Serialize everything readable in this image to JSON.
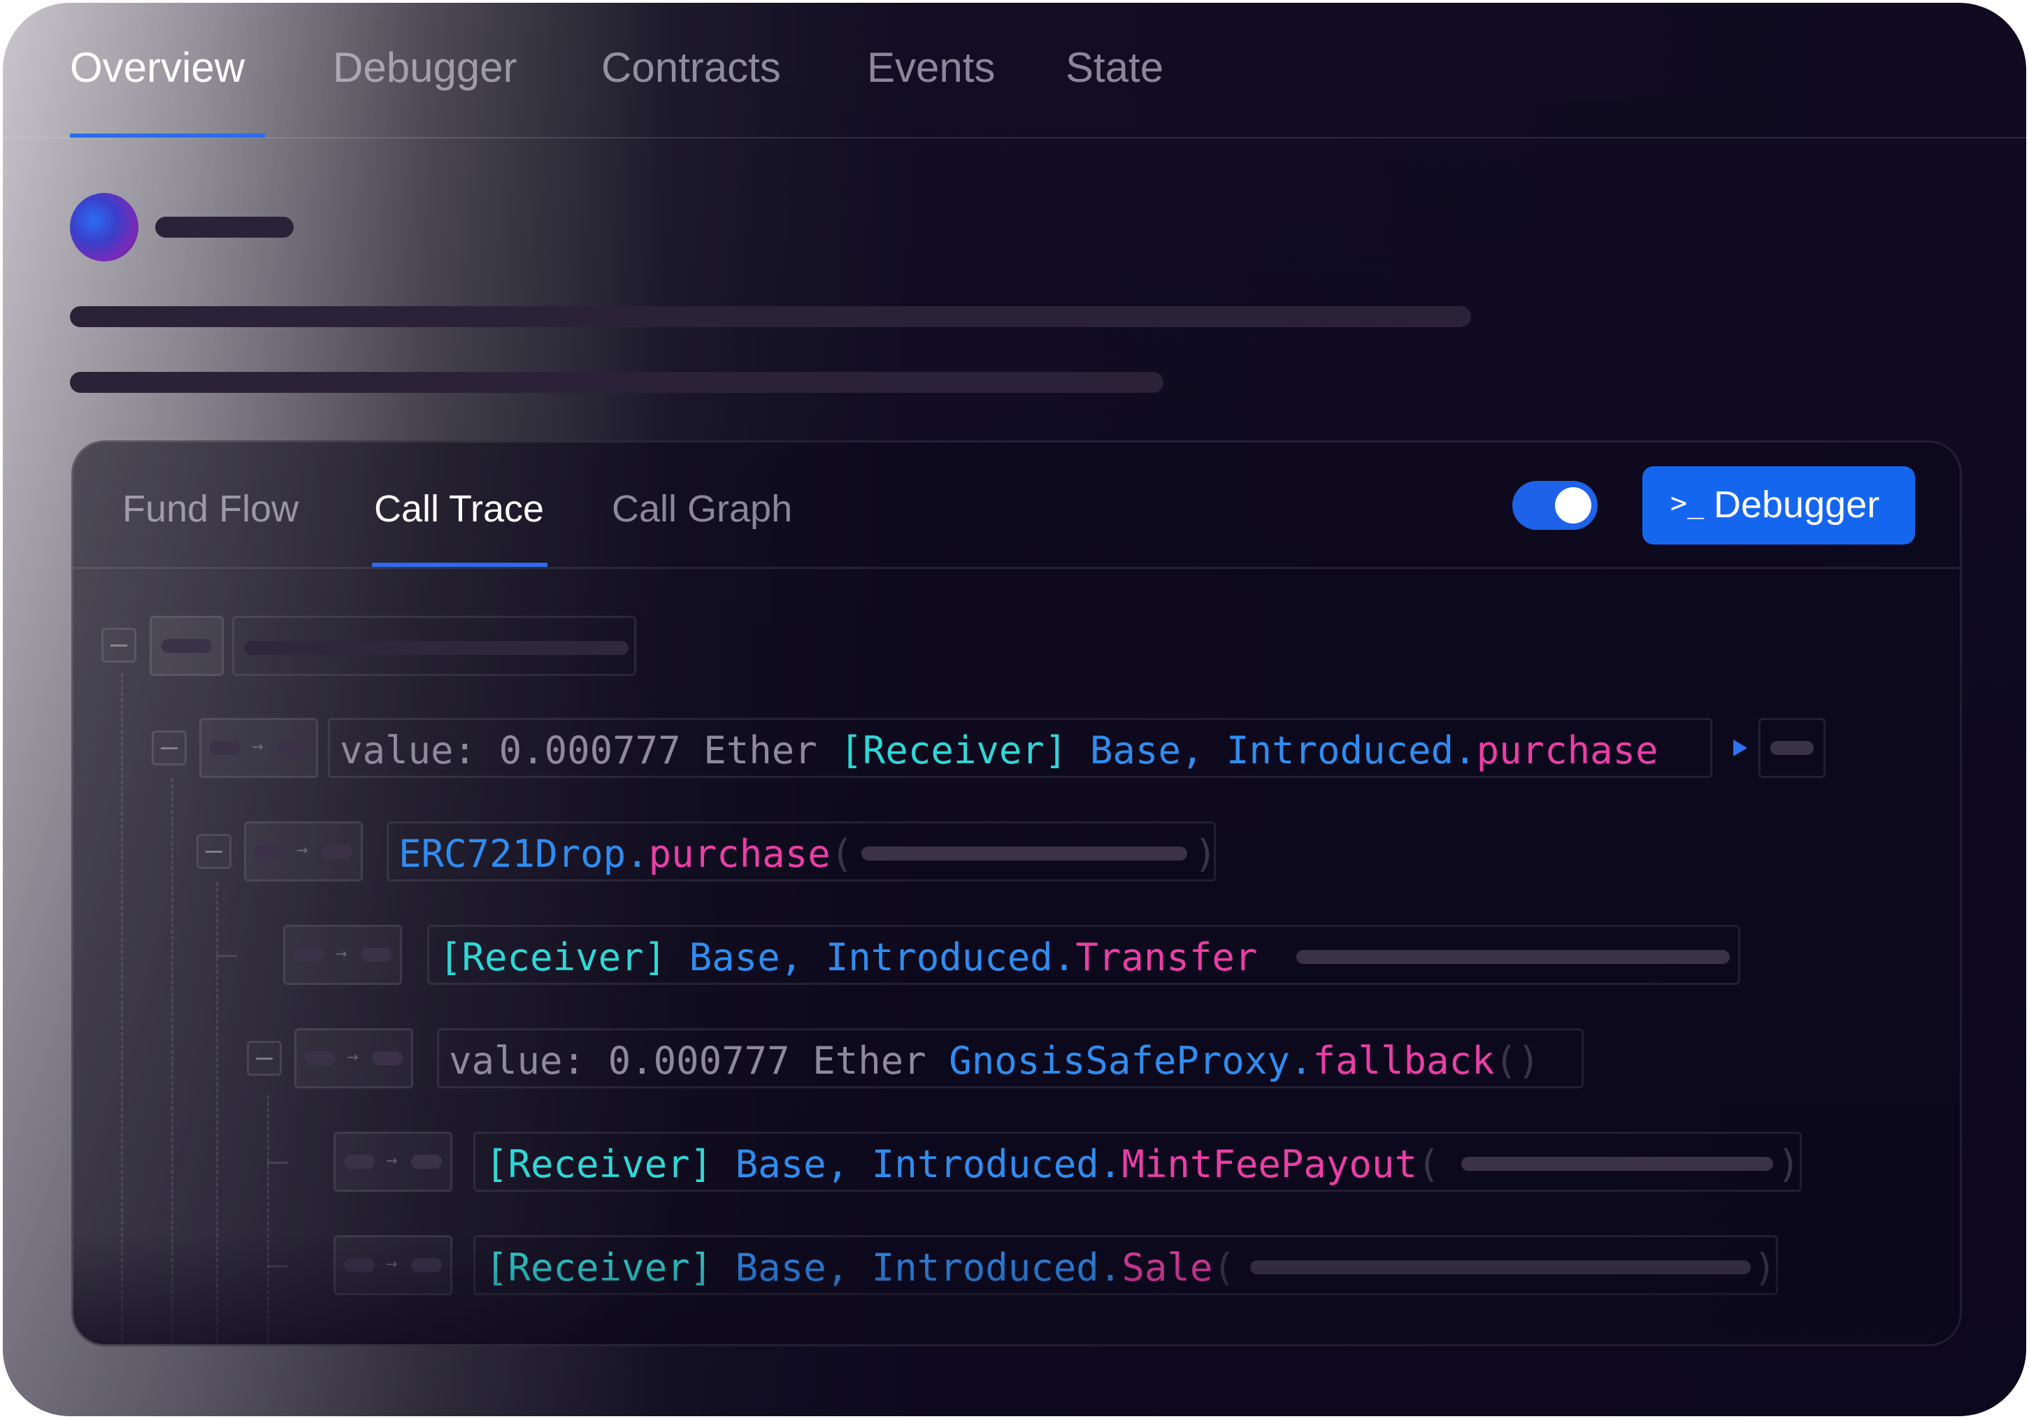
{
  "tabs": [
    {
      "label": "Overview"
    },
    {
      "label": "Debugger"
    },
    {
      "label": "Contracts"
    },
    {
      "label": "Events"
    },
    {
      "label": "State"
    }
  ],
  "active_tab": "Overview",
  "panel": {
    "tabs": [
      {
        "label": "Fund Flow"
      },
      {
        "label": "Call Trace"
      },
      {
        "label": "Call Graph"
      }
    ],
    "active_tab": "Call Trace",
    "toggle_on": true,
    "debugger_button": {
      "label": "Debugger",
      "icon": "terminal-prompt-icon",
      "color": "#1566ee"
    }
  },
  "trace": {
    "row1": {
      "value_label": "value:",
      "value": "0.000777",
      "unit": "Ether",
      "receiver": "[Receiver]",
      "contract": "Base, Introduced",
      "dot": ".",
      "method": "purchase"
    },
    "row2": {
      "contract": "ERC721Drop",
      "dot": ".",
      "method": "purchase",
      "open_paren": "(",
      "close_paren": ")"
    },
    "row3": {
      "receiver": "[Receiver]",
      "contract": "Base, Introduced",
      "dot": ".",
      "method": "Transfer"
    },
    "row4": {
      "value_label": "value:",
      "value": "0.000777",
      "unit": "Ether",
      "contract": "GnosisSafeProxy",
      "dot": ".",
      "method": "fallback",
      "parens": "()"
    },
    "row5": {
      "receiver": "[Receiver]",
      "contract": "Base, Introduced",
      "dot": ".",
      "method": "MintFeePayout",
      "open_paren": "(",
      "close_paren": ")"
    },
    "row6": {
      "receiver": "[Receiver]",
      "contract": "Base, Introduced",
      "dot": ".",
      "method": "Sale",
      "open_paren": "(",
      "close_paren": ")"
    }
  },
  "colors": {
    "accent": "#2c6bf0",
    "receiver": "#2fd7d6",
    "contract": "#2f8df0",
    "method": "#ea3ea7",
    "value": "#8e8a9c"
  }
}
